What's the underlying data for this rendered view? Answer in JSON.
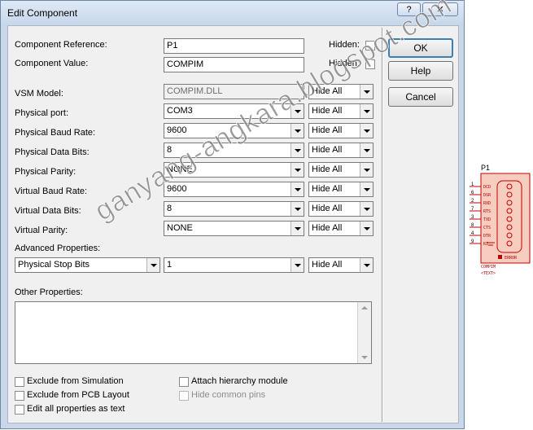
{
  "window": {
    "title": "Edit Component",
    "help_label": "?",
    "close_label": "✕"
  },
  "fields": {
    "component_reference": {
      "label": "Component Reference:",
      "value": "P1",
      "hidden_label": "Hidden:"
    },
    "component_value": {
      "label": "Component Value:",
      "value": "COMPIM",
      "hidden_label": "Hidden:"
    }
  },
  "properties": [
    {
      "label": "VSM Model:",
      "value": "COMPIM.DLL",
      "visibility": "Hide All"
    },
    {
      "label": "Physical port:",
      "value": "COM3",
      "visibility": "Hide All"
    },
    {
      "label": "Physical Baud Rate:",
      "value": "9600",
      "visibility": "Hide All"
    },
    {
      "label": "Physical Data Bits:",
      "value": "8",
      "visibility": "Hide All"
    },
    {
      "label": "Physical Parity:",
      "value": "NONE",
      "visibility": "Hide All"
    },
    {
      "label": "Virtual Baud Rate:",
      "value": "9600",
      "visibility": "Hide All"
    },
    {
      "label": "Virtual Data Bits:",
      "value": "8",
      "visibility": "Hide All"
    },
    {
      "label": "Virtual Parity:",
      "value": "NONE",
      "visibility": "Hide All"
    }
  ],
  "advanced": {
    "label": "Advanced Properties:",
    "property": "Physical Stop Bits",
    "value": "1",
    "visibility": "Hide All"
  },
  "other_properties": {
    "label": "Other Properties:",
    "text": ""
  },
  "options": {
    "exclude_simulation": "Exclude from Simulation",
    "exclude_pcb": "Exclude from PCB Layout",
    "edit_all_text": "Edit all properties as text",
    "attach_hierarchy": "Attach hierarchy module",
    "hide_common_pins": "Hide common pins"
  },
  "buttons": {
    "ok": "OK",
    "help": "Help",
    "cancel": "Cancel"
  },
  "watermark": "ganyang-angkara.blogspot.com",
  "schematic": {
    "reference": "P1",
    "pins": [
      "DCD",
      "DSR",
      "RXD",
      "RTS",
      "TXD",
      "CTS",
      "DTR",
      "RI"
    ],
    "pin_numbers": [
      "1",
      "6",
      "2",
      "7",
      "3",
      "8",
      "4",
      "9"
    ],
    "error_label": "ERROR",
    "component_name": "COMPIM",
    "text_label": "<TEXT>"
  },
  "colors": {
    "schematic_red": "#c00000",
    "default_button_border": "#3c7fb1"
  }
}
